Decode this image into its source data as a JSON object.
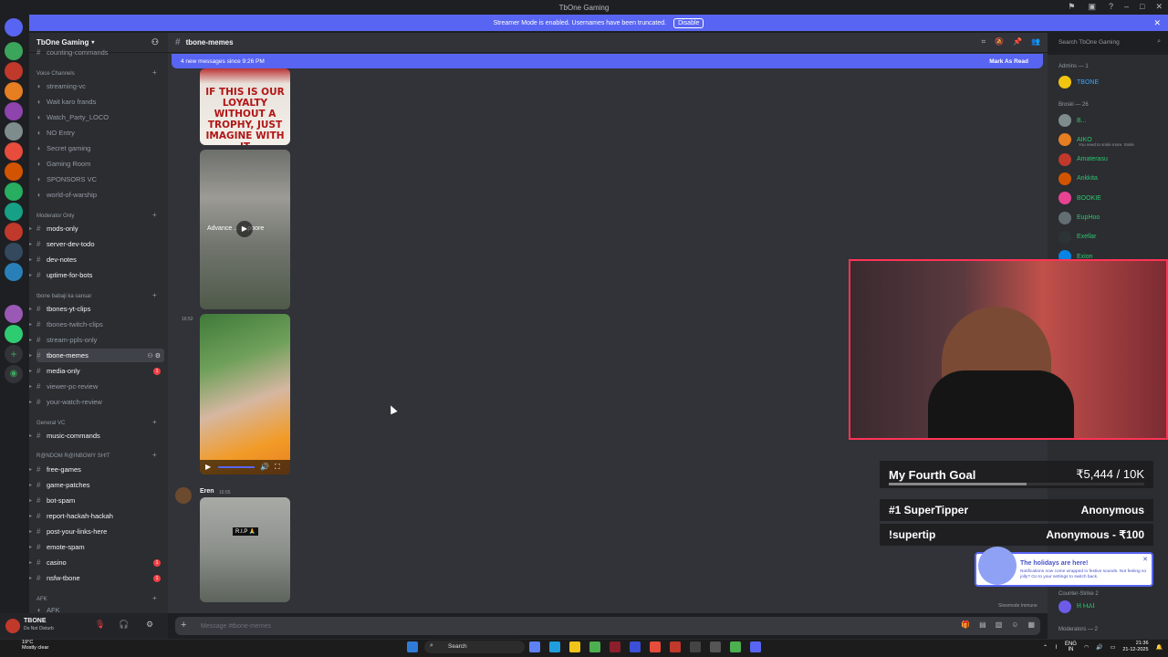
{
  "window": {
    "title": "TbOne Gaming"
  },
  "banner": {
    "text": "Streamer Mode is enabled. Usernames have been truncated.",
    "button": "Disable"
  },
  "server": {
    "name": "TbOne Gaming"
  },
  "sidebar": {
    "top_cut": "counting-commands",
    "categories": {
      "voice": "Voice Channels",
      "moderator": "Moderator Only",
      "tbone": "tbone babaji ka sansar",
      "general": "General VC",
      "random": "R@NDOM R@INBOWY SH!T",
      "afk": "AFK"
    },
    "voice_channels": [
      "streaming-vc",
      "Wait karo frands",
      "Watch_Party_LOCO",
      "NO Entry",
      "Secret gaming",
      "Gaming Room",
      "SPONSORS VC",
      "world-of-warship"
    ],
    "moderator_channels": [
      "mods-only",
      "server-dev-todo",
      "dev-notes",
      "uptime-for-bots"
    ],
    "tbone_channels": [
      "tbones-yt-clips",
      "tbones-twitch-clips",
      "stream-ppls-only",
      "tbone-memes",
      "media-only",
      "viewer-pc-review",
      "your-watch-review"
    ],
    "general_channels": [
      "music-commands"
    ],
    "random_channels": [
      "free-games",
      "game-patches",
      "bot-spam",
      "report-hackah-hackah",
      "post-your-links-here",
      "emote-spam",
      "casino",
      "nsfw-tbone"
    ],
    "afk_channel": "AFK"
  },
  "user": {
    "name": "TBONE",
    "status": "Do Not Disturb"
  },
  "channel": {
    "name": "tbone-memes"
  },
  "search": {
    "placeholder": "Search TbOne Gaming"
  },
  "new_messages": {
    "text": "4 new messages since 9:26 PM",
    "mark": "Mark As Read"
  },
  "messages": [
    {
      "image_text": "IF THIS IS OUR LOYALTY WITHOUT A TROPHY, JUST IMAGINE WITH IT"
    },
    {
      "image_text": "Advance ... ai poore"
    },
    {
      "timestamp": "16:52"
    },
    {
      "author": "Eren",
      "timestamp": "16:55",
      "image_text": "R.I.P 🙏"
    }
  ],
  "composer": {
    "placeholder": "Message #tbone-memes"
  },
  "members": {
    "admins_header": "Admins — 1",
    "admins": [
      {
        "name": "TBONE",
        "color": "#3ba5ff"
      }
    ],
    "broski_header": "Broski — 26",
    "broski": [
      {
        "name": "B...",
        "color": "#2dc770",
        "sub": ""
      },
      {
        "name": "AIKO",
        "color": "#2dc770",
        "sub": "You need to smile more. Smile"
      },
      {
        "name": "Amaterasu",
        "color": "#2dc770",
        "sub": ""
      },
      {
        "name": "Ankkita",
        "color": "#2dc770",
        "sub": ""
      },
      {
        "name": "BOOKIE",
        "color": "#2dc770",
        "sub": ""
      },
      {
        "name": "EupHoo",
        "color": "#2dc770",
        "sub": ""
      },
      {
        "name": "Exellar",
        "color": "#2dc770",
        "sub": ""
      },
      {
        "name": "Exion",
        "color": "#2dc770",
        "sub": ""
      }
    ],
    "bottom_sub": "Counter-Strike 2",
    "bottom_member": "Ⲏ ⲘⲀⲒ",
    "moderators_header": "Moderators — 2",
    "slowmode": "Slowmode Immune"
  },
  "goal": {
    "title": "My Fourth Goal",
    "amount": "₹5,444 / 10K",
    "supertipper_label": "#1 SuperTipper",
    "supertipper_value": "Anonymous",
    "command": "!supertip",
    "command_value": "Anonymous - ₹100"
  },
  "notification": {
    "title": "The holidays are here!",
    "body": "Notifications now come wrapped in festive sounds. Not feeling so jolly? Go to your settings to switch back."
  },
  "taskbar": {
    "weather_temp": "19°C",
    "weather_desc": "Mostly clear",
    "search": "Search",
    "lang": "ENG",
    "region": "IN",
    "time": "21:36",
    "date": "21-12-2025"
  }
}
